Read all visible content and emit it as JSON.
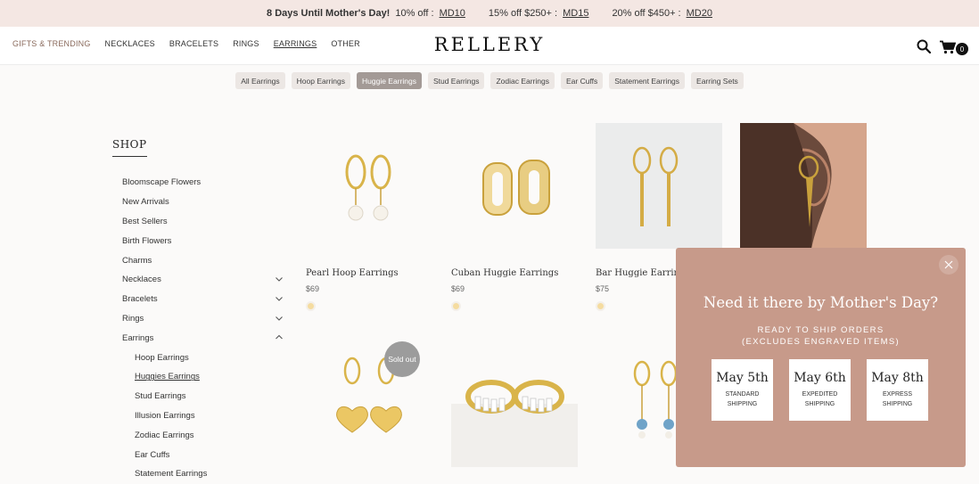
{
  "promo": {
    "headline": "8 Days Until Mother's Day!",
    "offer1_text": "10% off :",
    "offer1_code": "MD10",
    "offer2_text": "15% off $250+ :",
    "offer2_code": "MD15",
    "offer3_text": "20% off $450+ :",
    "offer3_code": "MD20"
  },
  "header": {
    "logo": "RELLERY",
    "nav": [
      "GIFTS & TRENDING",
      "NECKLACES",
      "BRACELETS",
      "RINGS",
      "EARRINGS",
      "OTHER"
    ],
    "cart_count": "0",
    "icons": [
      "search-icon",
      "cart-icon"
    ]
  },
  "categories": {
    "chips": [
      "All Earrings",
      "Hoop Earrings",
      "Huggie Earrings",
      "Stud Earrings",
      "Zodiac Earrings",
      "Ear Cuffs",
      "Statement Earrings",
      "Earring Sets"
    ],
    "active": "Huggie Earrings"
  },
  "sidebar": {
    "title": "SHOP",
    "items": [
      "Bloomscape Flowers",
      "New Arrivals",
      "Best Sellers",
      "Birth Flowers",
      "Charms",
      "Necklaces",
      "Bracelets",
      "Rings",
      "Earrings",
      "Hoop Earrings",
      "Huggies Earrings",
      "Stud Earrings",
      "Illusion Earrings",
      "Zodiac Earrings",
      "Ear Cuffs",
      "Statement Earrings"
    ]
  },
  "products": [
    {
      "name": "Pearl Hoop Earrings",
      "price": "$69"
    },
    {
      "name": "Cuban Huggie Earrings",
      "price": "$69"
    },
    {
      "name": "Bar Huggie Earring",
      "price": "$75"
    }
  ],
  "badges": {
    "sold_out": "Sold out"
  },
  "popup": {
    "title": "Need it there by Mother's Day?",
    "subtitle_line1": "Ready to ship orders",
    "subtitle_line2": "(excludes engraved items)",
    "options": [
      {
        "date": "May 5th",
        "line1": "Standard",
        "line2": "Shipping"
      },
      {
        "date": "May 6th",
        "line1": "Expedited",
        "line2": "Shipping"
      },
      {
        "date": "May 8th",
        "line1": "Express",
        "line2": "Shipping"
      }
    ]
  },
  "colors": {
    "promo_bg": "#f4e7e3",
    "popup_bg": "#c79a8a",
    "active_chip": "#a39a96",
    "gold": "#d9b44a"
  }
}
